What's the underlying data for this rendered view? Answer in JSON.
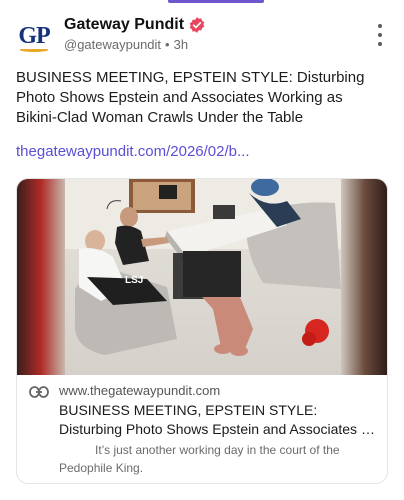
{
  "account": {
    "display_name": "Gateway Pundit",
    "handle": "@gatewaypundit",
    "separator": "•",
    "time_ago": "3h",
    "avatar_text": "GP",
    "verified": true
  },
  "post": {
    "text": "BUSINESS MEETING, EPSTEIN STYLE: Disturbing Photo Shows Epstein and Associates Working as Bikini-Clad Woman Crawls Under the Table",
    "link_text": "thegatewaypundit.com/2026/02/b..."
  },
  "link_card": {
    "domain": "www.thegatewaypundit.com",
    "title_line1": "BUSINESS MEETING, EPSTEIN STYLE:",
    "title_line2": "Disturbing Photo Shows Epstein and Associates Working as Bikini-Clad Woman Crawls Under the Table",
    "description_line1": "It’s just another working day in the court of the",
    "description_line2": "Pedophile King.",
    "image_caption": "LSJ"
  },
  "icons": {
    "verified": "verified-badge-icon",
    "more": "more-options-icon",
    "link": "link-icon"
  },
  "colors": {
    "accent": "#6e56cf",
    "link": "#5b4fd3",
    "verified_badge": "#e8475f",
    "avatar_text": "#15327a",
    "avatar_swoosh": "#e8a92a"
  }
}
